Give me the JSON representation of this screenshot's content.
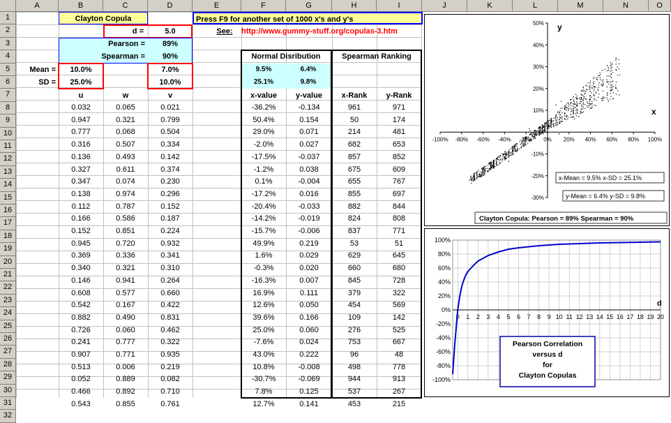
{
  "columns": [
    "A",
    "B",
    "C",
    "D",
    "E",
    "F",
    "G",
    "H",
    "I",
    "J",
    "K",
    "L",
    "M",
    "N",
    "O"
  ],
  "rows": [
    "1",
    "2",
    "3",
    "4",
    "5",
    "6",
    "7",
    "8",
    "9",
    "10",
    "11",
    "12",
    "13",
    "14",
    "15",
    "16",
    "17",
    "18",
    "19",
    "20",
    "21",
    "22",
    "23",
    "24",
    "25",
    "26",
    "27",
    "28",
    "29",
    "30",
    "31",
    "32"
  ],
  "header": {
    "title": "Clayton Copula",
    "press_f9": "Press F9 for another set of 1000 x's and y's",
    "d_label": "d =",
    "d_value": "5.0",
    "see_label": "See:",
    "see_url": "http://www.gummy-stuff.org/copulas-3.htm",
    "pearson_label": "Pearson =",
    "pearson_value": "89%",
    "spearman_label": "Spearman =",
    "spearman_value": "90%",
    "mean_label": "Mean =",
    "sd_label": "SD =",
    "mean_x": "10.0%",
    "sd_x": "25.0%",
    "mean_y": "7.0%",
    "sd_y": "10.0%",
    "normal_dist_label": "Normal Disribution",
    "spearman_ranking_label": "Spearman Ranking",
    "nd_mean_x": "9.5%",
    "nd_mean_y": "6.4%",
    "nd_sd_x": "25.1%",
    "nd_sd_y": "9.8%"
  },
  "table_headers": [
    "u",
    "w",
    "v",
    "x-value",
    "y-value",
    "x-Rank",
    "y-Rank"
  ],
  "table_rows": [
    [
      "0.032",
      "0.065",
      "0.021",
      "-36.2%",
      "-0.134",
      "961",
      "971"
    ],
    [
      "0.947",
      "0.321",
      "0.799",
      "50.4%",
      "0.154",
      "50",
      "174"
    ],
    [
      "0.777",
      "0.068",
      "0.504",
      "29.0%",
      "0.071",
      "214",
      "481"
    ],
    [
      "0.316",
      "0.507",
      "0.334",
      "-2.0%",
      "0.027",
      "682",
      "653"
    ],
    [
      "0.136",
      "0.493",
      "0.142",
      "-17.5%",
      "-0.037",
      "857",
      "852"
    ],
    [
      "0.327",
      "0.611",
      "0.374",
      "-1.2%",
      "0.038",
      "675",
      "609"
    ],
    [
      "0.347",
      "0.074",
      "0.230",
      "0.1%",
      "-0.004",
      "655",
      "767"
    ],
    [
      "0.138",
      "0.974",
      "0.296",
      "-17.2%",
      "0.016",
      "855",
      "697"
    ],
    [
      "0.112",
      "0.787",
      "0.152",
      "-20.4%",
      "-0.033",
      "882",
      "844"
    ],
    [
      "0.166",
      "0.586",
      "0.187",
      "-14.2%",
      "-0.019",
      "824",
      "808"
    ],
    [
      "0.152",
      "0.851",
      "0.224",
      "-15.7%",
      "-0.006",
      "837",
      "771"
    ],
    [
      "0.945",
      "0.720",
      "0.932",
      "49.9%",
      "0.219",
      "53",
      "51"
    ],
    [
      "0.369",
      "0.336",
      "0.341",
      "1.6%",
      "0.029",
      "629",
      "645"
    ],
    [
      "0.340",
      "0.321",
      "0.310",
      "-0.3%",
      "0.020",
      "660",
      "680"
    ],
    [
      "0.146",
      "0.941",
      "0.264",
      "-16.3%",
      "0.007",
      "845",
      "728"
    ],
    [
      "0.608",
      "0.577",
      "0.660",
      "16.9%",
      "0.111",
      "379",
      "322"
    ],
    [
      "0.542",
      "0.167",
      "0.422",
      "12.6%",
      "0.050",
      "454",
      "569"
    ],
    [
      "0.882",
      "0.490",
      "0.831",
      "39.6%",
      "0.166",
      "109",
      "142"
    ],
    [
      "0.726",
      "0.060",
      "0.462",
      "25.0%",
      "0.060",
      "276",
      "525"
    ],
    [
      "0.241",
      "0.777",
      "0.322",
      "-7.6%",
      "0.024",
      "753",
      "667"
    ],
    [
      "0.907",
      "0.771",
      "0.935",
      "43.0%",
      "0.222",
      "96",
      "48"
    ],
    [
      "0.513",
      "0.006",
      "0.219",
      "10.8%",
      "-0.008",
      "498",
      "778"
    ],
    [
      "0.052",
      "0.889",
      "0.082",
      "-30.7%",
      "-0.069",
      "944",
      "913"
    ],
    [
      "0.466",
      "0.892",
      "0.710",
      "7.8%",
      "0.125",
      "537",
      "267"
    ],
    [
      "0.543",
      "0.855",
      "0.761",
      "12.7%",
      "0.141",
      "453",
      "215"
    ]
  ],
  "chart_data": [
    {
      "type": "scatter",
      "title": "",
      "xlabel": "x",
      "ylabel": "y",
      "x_ticks": [
        "-100%",
        "-80%",
        "-60%",
        "-40%",
        "-20%",
        "0%",
        "20%",
        "40%",
        "60%",
        "80%",
        "100%"
      ],
      "y_ticks": [
        "50%",
        "40%",
        "30%",
        "20%",
        "10%",
        "0%",
        "-10%",
        "-20%",
        "-30%"
      ],
      "xlim": [
        -1.0,
        1.0
      ],
      "ylim": [
        -0.3,
        0.5
      ],
      "x_mean_sd": "x-Mean = 9.5%  x-SD = 25.1%",
      "y_mean_sd": "y-Mean = 6.4%  y-SD = 9.8%",
      "footer": "Clayton Copula:  Pearson = 89%  Spearman = 90%",
      "point_color": "#000000",
      "points": [
        [
          -0.362,
          -0.134
        ],
        [
          0.504,
          0.154
        ],
        [
          0.29,
          0.071
        ],
        [
          -0.02,
          0.027
        ],
        [
          -0.175,
          -0.037
        ],
        [
          -0.012,
          0.038
        ],
        [
          0.001,
          -0.004
        ],
        [
          -0.172,
          0.016
        ],
        [
          -0.204,
          -0.033
        ],
        [
          -0.142,
          -0.019
        ],
        [
          -0.157,
          -0.006
        ],
        [
          0.499,
          0.219
        ],
        [
          0.016,
          0.029
        ],
        [
          -0.003,
          0.02
        ],
        [
          -0.163,
          0.007
        ],
        [
          0.169,
          0.111
        ],
        [
          0.126,
          0.05
        ],
        [
          0.396,
          0.166
        ],
        [
          0.25,
          0.06
        ],
        [
          -0.076,
          0.024
        ],
        [
          0.43,
          0.222
        ],
        [
          0.108,
          -0.008
        ],
        [
          -0.307,
          -0.069
        ],
        [
          0.078,
          0.125
        ],
        [
          0.127,
          0.141
        ]
      ]
    },
    {
      "type": "line",
      "title": "Pearson Correlation versus d for Clayton Copulas",
      "title_lines": [
        "Pearson Correlation",
        "versus d",
        "for",
        "Clayton Copulas"
      ],
      "xlabel": "d",
      "ylabel": "",
      "x_ticks": [
        "0",
        "1",
        "2",
        "3",
        "4",
        "5",
        "6",
        "7",
        "8",
        "9",
        "10",
        "11",
        "12",
        "13",
        "14",
        "15",
        "16",
        "17",
        "18",
        "19",
        "20"
      ],
      "y_ticks": [
        "100%",
        "80%",
        "60%",
        "40%",
        "20%",
        "0%",
        "-20%",
        "-40%",
        "-60%",
        "-80%",
        "-100%"
      ],
      "xlim": [
        -0.5,
        20
      ],
      "ylim": [
        -1.0,
        1.0
      ],
      "line_color": "#0000cc",
      "x": [
        -0.5,
        -0.4,
        -0.3,
        -0.2,
        -0.1,
        0,
        0.2,
        0.4,
        0.6,
        0.8,
        1,
        1.5,
        2,
        3,
        4,
        5,
        6,
        8,
        10,
        12,
        14,
        16,
        18,
        20
      ],
      "values": [
        -0.92,
        -0.7,
        -0.5,
        -0.33,
        -0.16,
        0.0,
        0.2,
        0.34,
        0.43,
        0.5,
        0.55,
        0.63,
        0.7,
        0.78,
        0.83,
        0.87,
        0.89,
        0.92,
        0.94,
        0.95,
        0.96,
        0.965,
        0.97,
        0.975
      ]
    }
  ]
}
